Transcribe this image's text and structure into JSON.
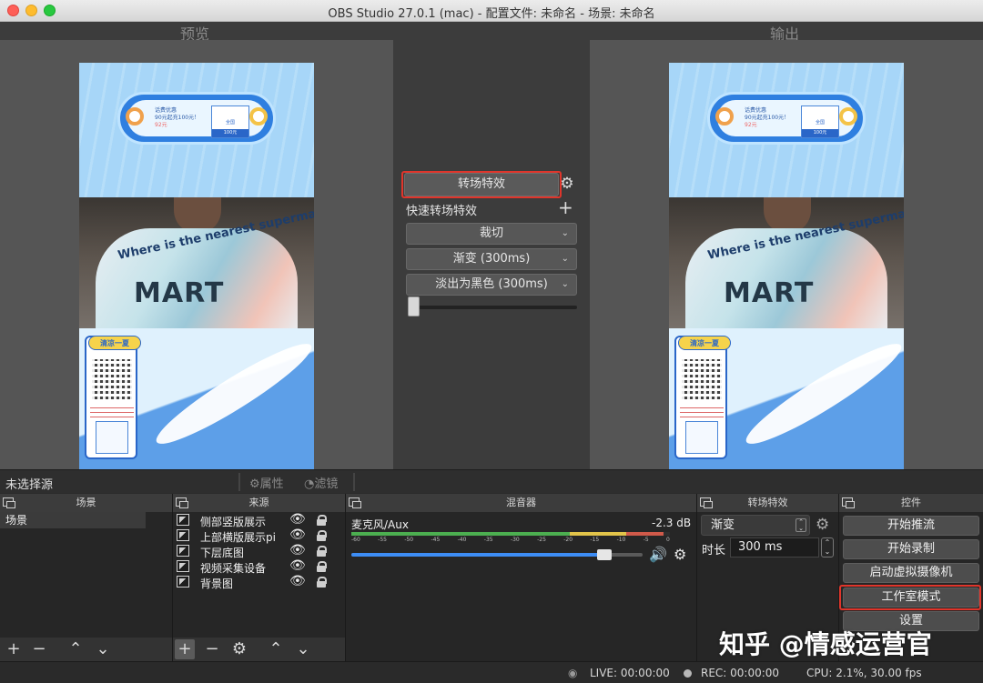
{
  "window": {
    "title": "OBS Studio 27.0.1 (mac) - 配置文件: 未命名 - 场景: 未命名"
  },
  "preview": {
    "label": "预览"
  },
  "program": {
    "label": "输出"
  },
  "canvas_art": {
    "shirt_text": "Where is the nearest supermarket?",
    "mart_text": "MART",
    "qr_title": "清凉一夏",
    "promo_line1": "话费优惠",
    "promo_line2": "90元起充100元！",
    "promo_price": "92元",
    "card_label": "全国",
    "card_band": "100元"
  },
  "studio_transition": {
    "transition_button": "转场特效",
    "quick_label": "快速转场特效",
    "quick_items": [
      "裁切",
      "渐变 (300ms)",
      "淡出为黑色 (300ms)"
    ]
  },
  "source_toolbar": {
    "no_source": "未选择源",
    "properties": "属性",
    "filters": "滤镜"
  },
  "docks": {
    "scenes": {
      "title": "场景",
      "items": [
        "场景"
      ]
    },
    "sources": {
      "title": "来源",
      "items": [
        "侧部竖版展示",
        "上部横版展示pi",
        "下层底图",
        "视频采集设备",
        "背景图"
      ]
    },
    "mixer": {
      "title": "混音器",
      "channel": "麦克风/Aux",
      "db": "-2.3 dB",
      "ticks": [
        "-60",
        "-55",
        "-50",
        "-45",
        "-40",
        "-35",
        "-30",
        "-25",
        "-20",
        "-15",
        "-10",
        "-5",
        "0"
      ],
      "meter_level": 0.98,
      "volume_level": 0.87
    },
    "transitions": {
      "title": "转场特效",
      "selected": "渐变",
      "duration_label": "时长",
      "duration_value": "300 ms"
    },
    "controls": {
      "title": "控件",
      "buttons": [
        "开始推流",
        "开始录制",
        "启动虚拟摄像机",
        "工作室模式",
        "设置"
      ]
    }
  },
  "status": {
    "live": "LIVE: 00:00:00",
    "rec": "REC: 00:00:00",
    "cpu": "CPU: 2.1%, 30.00 fps"
  },
  "watermark": "知乎 @情感运营官",
  "colors": {
    "highlight": "#e0352b",
    "volume": "#3d8df5",
    "background": "#2b2b2b"
  }
}
